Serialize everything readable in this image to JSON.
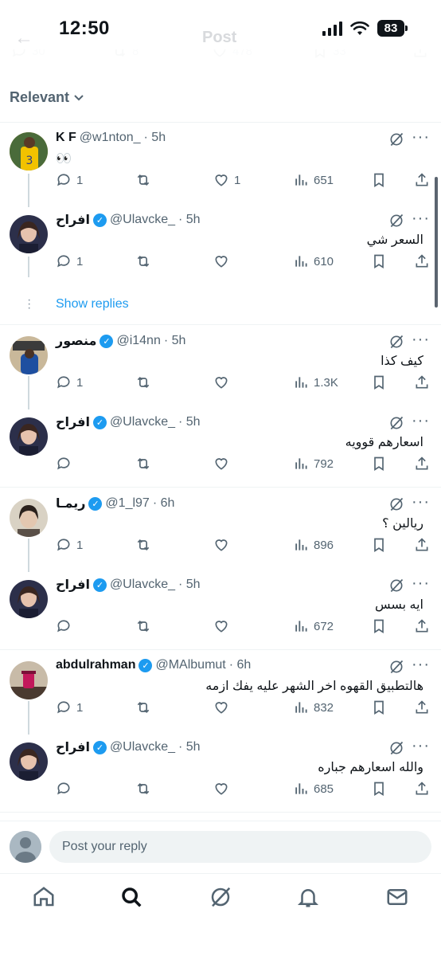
{
  "status_bar": {
    "time": "12:50",
    "battery": "83"
  },
  "header": {
    "title": "Post"
  },
  "top_stats": {
    "replies": "30",
    "reposts": "8",
    "likes": "478",
    "bookmarks": "33"
  },
  "sort": {
    "label": "Relevant"
  },
  "threads": [
    {
      "tweets": [
        {
          "name": "K F",
          "handle": "@w1nton_",
          "time": "· 5h",
          "verified": false,
          "text": "👀",
          "replies": "1",
          "reposts": "",
          "likes": "1",
          "views": "651"
        },
        {
          "name": "افراح",
          "handle": "@Ulavcke_",
          "time": "· 5h",
          "verified": true,
          "text": "السعر شي",
          "replies": "1",
          "reposts": "",
          "likes": "",
          "views": "610"
        }
      ],
      "show_replies": "Show replies"
    },
    {
      "tweets": [
        {
          "name": "منصور",
          "handle": "@i14nn",
          "time": "· 5h",
          "verified": true,
          "text": "كيف كذا",
          "replies": "1",
          "reposts": "",
          "likes": "",
          "views": "1.3K"
        },
        {
          "name": "افراح",
          "handle": "@Ulavcke_",
          "time": "· 5h",
          "verified": true,
          "text": "اسعارهم قوويه",
          "replies": "",
          "reposts": "",
          "likes": "",
          "views": "792"
        }
      ]
    },
    {
      "tweets": [
        {
          "name": "ريمـا",
          "handle": "@1_l97",
          "time": "· 6h",
          "verified": true,
          "text": "ريالين ؟",
          "replies": "1",
          "reposts": "",
          "likes": "",
          "views": "896"
        },
        {
          "name": "افراح",
          "handle": "@Ulavcke_",
          "time": "· 5h",
          "verified": true,
          "text": "ايه بسس",
          "replies": "",
          "reposts": "",
          "likes": "",
          "views": "672"
        }
      ]
    },
    {
      "tweets": [
        {
          "name": "abdulrahman",
          "handle": "@MAlbumut",
          "time": "· 6h",
          "verified": true,
          "text": "هالتطبيق القهوه اخر الشهر عليه يفك ازمه",
          "replies": "1",
          "reposts": "",
          "likes": "",
          "views": "832"
        },
        {
          "name": "افراح",
          "handle": "@Ulavcke_",
          "time": "· 5h",
          "verified": true,
          "text": "والله اسعارهم جباره",
          "replies": "",
          "reposts": "",
          "likes": "",
          "views": "685"
        }
      ]
    }
  ],
  "reply_bar": {
    "placeholder": "Post your reply"
  },
  "colors": {
    "accent": "#1d9bf0",
    "text": "#0f1419",
    "muted": "#536471"
  }
}
